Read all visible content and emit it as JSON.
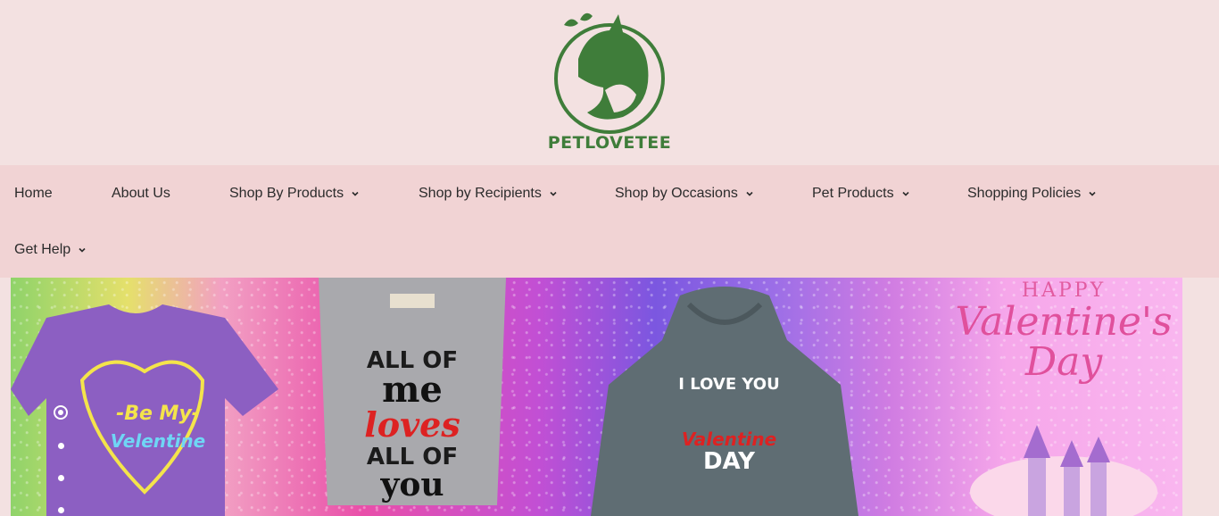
{
  "brand": {
    "name": "PETLOVETEE",
    "logo_icon": "pet-silhouette-logo",
    "color": "#3f7d3a"
  },
  "nav": {
    "items": [
      {
        "label": "Home",
        "has_dropdown": false
      },
      {
        "label": "About Us",
        "has_dropdown": false
      },
      {
        "label": "Shop By Products",
        "has_dropdown": true
      },
      {
        "label": "Shop by Recipients",
        "has_dropdown": true
      },
      {
        "label": "Shop by Occasions",
        "has_dropdown": true
      },
      {
        "label": "Pet Products",
        "has_dropdown": true
      },
      {
        "label": "Shopping Policies",
        "has_dropdown": true
      },
      {
        "label": "Get Help",
        "has_dropdown": true
      }
    ]
  },
  "banner": {
    "shirt1": {
      "line1": "-Be My-",
      "line2": "Velentine"
    },
    "shirt2": {
      "line1": "ALL OF",
      "line2": "me",
      "line3": "loves",
      "line4": "ALL OF",
      "line5": "you"
    },
    "hoodie": {
      "line1": "I LOVE YOU",
      "line2": "Valentine",
      "line3": "DAY"
    },
    "greeting": {
      "line1": "HAPPY",
      "line2": "Valentine's",
      "line3": "Day"
    },
    "slides": {
      "count": 4,
      "active_index": 0
    }
  },
  "colors": {
    "page_bg": "#f3e1e1",
    "nav_bg": "#f1d3d4",
    "text": "#2b2b2b"
  }
}
